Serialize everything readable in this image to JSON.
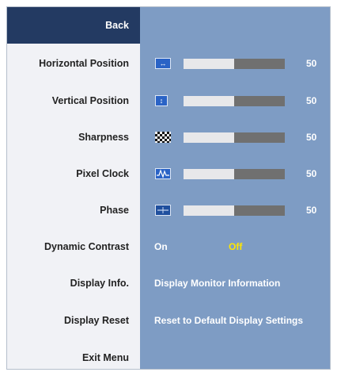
{
  "menu": {
    "back": "Back",
    "horizontal_position": "Horizontal Position",
    "vertical_position": "Vertical Position",
    "sharpness": "Sharpness",
    "pixel_clock": "Pixel Clock",
    "phase": "Phase",
    "dynamic_contrast": "Dynamic Contrast",
    "display_info": "Display Info.",
    "display_reset": "Display Reset",
    "exit_menu": "Exit Menu"
  },
  "settings": {
    "horizontal_position": {
      "value": "50",
      "level": 0.5,
      "icon": "horizontal-arrows-icon"
    },
    "vertical_position": {
      "value": "50",
      "level": 0.5,
      "icon": "vertical-arrows-icon"
    },
    "sharpness": {
      "value": "50",
      "level": 0.5,
      "icon": "checkerboard-icon"
    },
    "pixel_clock": {
      "value": "50",
      "level": 0.5,
      "icon": "waveform-icon"
    },
    "phase": {
      "value": "50",
      "level": 0.5,
      "icon": "phase-icon"
    },
    "dynamic_contrast": {
      "on": "On",
      "off": "Off",
      "selected": "Off"
    },
    "display_info": "Display Monitor Information",
    "display_reset": "Reset to Default Display Settings"
  },
  "colors": {
    "panel": "#7e9cc4",
    "selected_item": "#233a62",
    "highlight_option": "#ffe600"
  }
}
